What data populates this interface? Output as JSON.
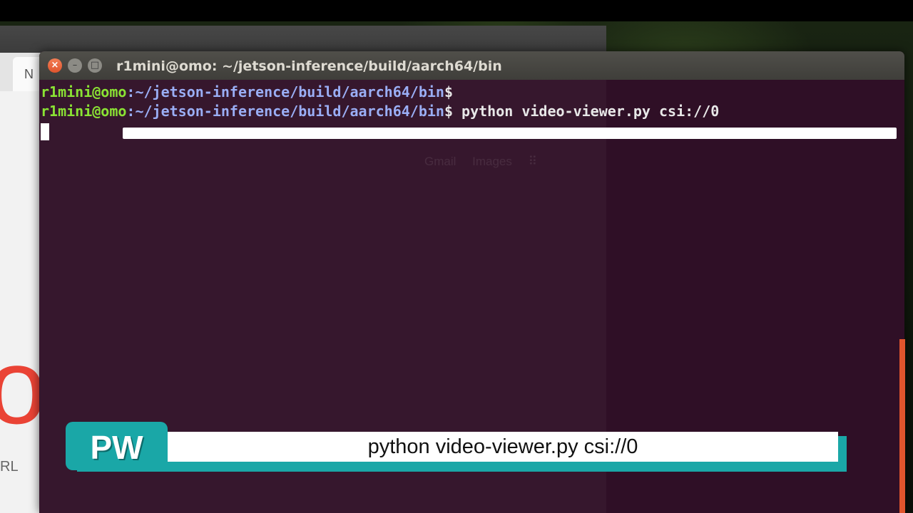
{
  "browser": {
    "tab_label": "N",
    "url_fragment": "RL",
    "google_logo": "oogle"
  },
  "terminal": {
    "title": "r1mini@omo: ~/jetson-inference/build/aarch64/bin",
    "lines": [
      {
        "user": "r1mini@omo",
        "path": ":~/jetson-inference/build/aarch64/bin",
        "symbol": "$",
        "command": ""
      },
      {
        "user": "r1mini@omo",
        "path": ":~/jetson-inference/build/aarch64/bin",
        "symbol": "$",
        "command": " python video-viewer.py csi://0"
      }
    ],
    "ghost_links": [
      "Gmail",
      "Images"
    ]
  },
  "caption": {
    "logo": "PW",
    "text": "python video-viewer.py csi://0"
  },
  "colors": {
    "terminal_bg": "#2f0f26",
    "prompt_user": "#8ae234",
    "prompt_path": "#9aaef5",
    "caption_accent": "#1aa7a7",
    "close_button": "#e0552d"
  }
}
